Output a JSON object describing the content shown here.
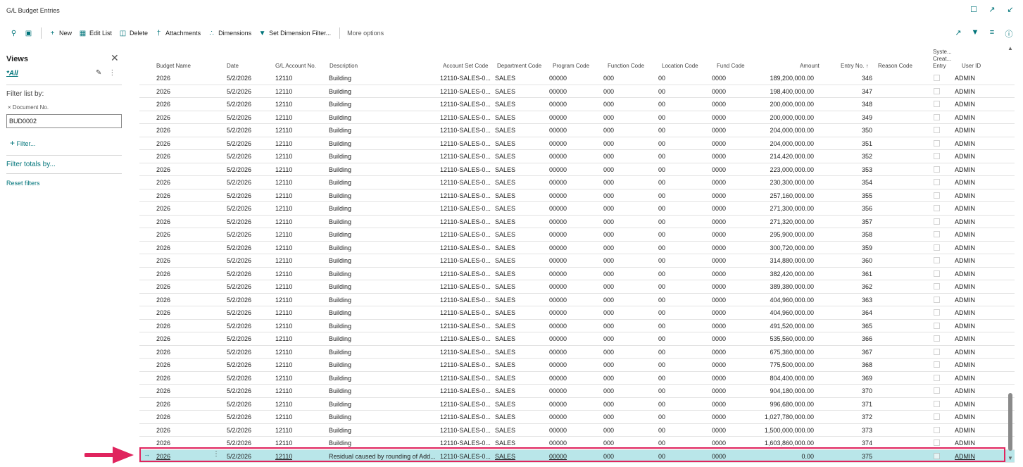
{
  "window": {
    "title": "G/L Budget Entries"
  },
  "toolbar": {
    "new_label": "New",
    "edit_list_label": "Edit List",
    "delete_label": "Delete",
    "attachments_label": "Attachments",
    "dimensions_label": "Dimensions",
    "set_dim_filter_label": "Set Dimension Filter...",
    "more_options_label": "More options"
  },
  "pane": {
    "views_title": "Views",
    "view_all": "*All",
    "filter_list_label": "Filter list by:",
    "field_name": "Document No.",
    "field_value": "BUD0002",
    "add_filter": "Filter...",
    "filter_totals": "Filter totals by...",
    "reset_filters": "Reset filters"
  },
  "grid": {
    "headers": {
      "budget_name": "Budget Name",
      "date": "Date",
      "gl_account": "G/L Account No.",
      "description": "Description",
      "account_set_code": "Account Set Code",
      "department_code": "Department Code",
      "program_code": "Program Code",
      "function_code": "Function Code",
      "location_code": "Location Code",
      "fund_code": "Fund Code",
      "amount": "Amount",
      "entry_no": "Entry No. ↑",
      "reason_code": "Reason Code",
      "system_created_1": "Syste...",
      "system_created_2": "Creat...",
      "system_created_3": "Entry",
      "user_id": "User ID"
    },
    "common": {
      "budget": "2026",
      "date": "5/2/2026",
      "account": "12110",
      "description": "Building",
      "account_set": "12110-SALES-0...",
      "department": "SALES",
      "program": "00000",
      "function": "000",
      "location": "00",
      "fund": "0000",
      "user": "ADMIN"
    },
    "rows": [
      {
        "amount": "189,200,000.00",
        "entry": "346"
      },
      {
        "amount": "198,400,000.00",
        "entry": "347"
      },
      {
        "amount": "200,000,000.00",
        "entry": "348"
      },
      {
        "amount": "200,000,000.00",
        "entry": "349"
      },
      {
        "amount": "204,000,000.00",
        "entry": "350"
      },
      {
        "amount": "204,000,000.00",
        "entry": "351"
      },
      {
        "amount": "214,420,000.00",
        "entry": "352"
      },
      {
        "amount": "223,000,000.00",
        "entry": "353"
      },
      {
        "amount": "230,300,000.00",
        "entry": "354"
      },
      {
        "amount": "257,160,000.00",
        "entry": "355"
      },
      {
        "amount": "271,300,000.00",
        "entry": "356"
      },
      {
        "amount": "271,320,000.00",
        "entry": "357"
      },
      {
        "amount": "295,900,000.00",
        "entry": "358"
      },
      {
        "amount": "300,720,000.00",
        "entry": "359"
      },
      {
        "amount": "314,880,000.00",
        "entry": "360"
      },
      {
        "amount": "382,420,000.00",
        "entry": "361"
      },
      {
        "amount": "389,380,000.00",
        "entry": "362"
      },
      {
        "amount": "404,960,000.00",
        "entry": "363"
      },
      {
        "amount": "404,960,000.00",
        "entry": "364"
      },
      {
        "amount": "491,520,000.00",
        "entry": "365"
      },
      {
        "amount": "535,560,000.00",
        "entry": "366"
      },
      {
        "amount": "675,360,000.00",
        "entry": "367"
      },
      {
        "amount": "775,500,000.00",
        "entry": "368"
      },
      {
        "amount": "804,400,000.00",
        "entry": "369"
      },
      {
        "amount": "904,180,000.00",
        "entry": "370"
      },
      {
        "amount": "996,680,000.00",
        "entry": "371"
      },
      {
        "amount": "1,027,780,000.00",
        "entry": "372"
      },
      {
        "amount": "1,500,000,000.00",
        "entry": "373"
      },
      {
        "amount": "1,603,860,000.00",
        "entry": "374"
      }
    ],
    "selected_row": {
      "budget": "2026",
      "date": "5/2/2026",
      "account": "12110",
      "description": "Residual caused by rounding of Add...",
      "account_set": "12110-SALES-0...",
      "department": "SALES",
      "program": "00000",
      "function": "000",
      "location": "00",
      "fund": "0000",
      "amount": "0.00",
      "entry": "375",
      "user": "ADMIN"
    }
  },
  "colors": {
    "accent": "#00747a",
    "selected_row": "#b9e6e9",
    "highlight": "#e0245e"
  }
}
